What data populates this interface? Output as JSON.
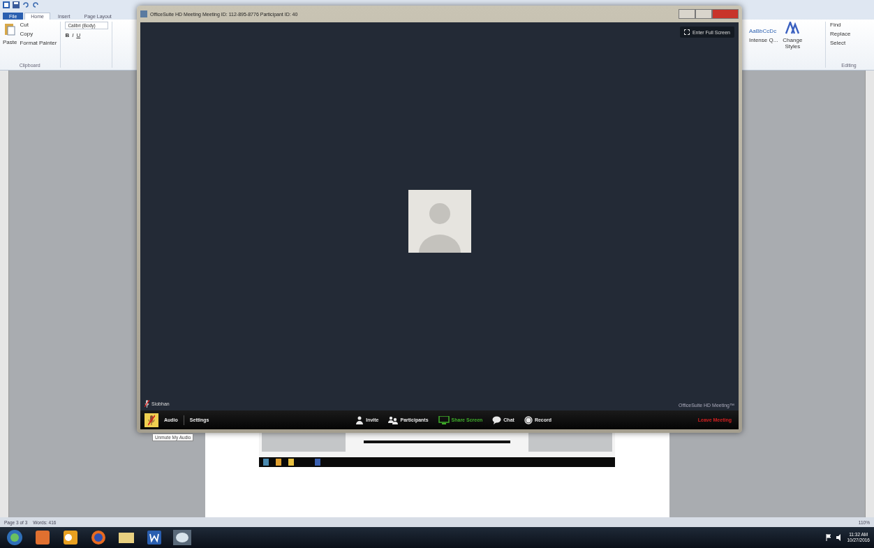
{
  "word": {
    "tabs": [
      {
        "label": "File",
        "selected": false,
        "kind": "file"
      },
      {
        "label": "Home",
        "selected": true,
        "kind": "tab"
      },
      {
        "label": "Insert",
        "selected": false,
        "kind": "tab"
      },
      {
        "label": "Page Layout",
        "selected": false,
        "kind": "tab"
      }
    ],
    "clipboard": {
      "paste": "Paste",
      "cut": "Cut",
      "copy": "Copy",
      "format_painter": "Format Painter",
      "group": "Clipboard"
    },
    "font": {
      "name": "Calibri (Body)",
      "bold": "B",
      "italic": "I",
      "underline": "U"
    },
    "styles": {
      "sample": "AaBbCcDc",
      "style_name": "Intense Q...",
      "change_styles": "Change Styles"
    },
    "editing": {
      "find": "Find",
      "replace": "Replace",
      "select": "Select",
      "group": "Editing"
    },
    "status_bar": {
      "page": "Page 3 of 3",
      "words": "Words: 416",
      "zoom": "110%"
    }
  },
  "meeting": {
    "title": "OfficeSuite HD Meeting Meeting ID: 112-895-8776 Participant ID: 40",
    "full_screen": "Enter Full Screen",
    "participant_name": "Siobhan",
    "branding": "OfficeSuite HD Meeting™",
    "muted": true,
    "left_controls": [
      "Audio",
      "Settings"
    ],
    "toolbar": [
      {
        "label": "Invite",
        "kind": "invite",
        "color": "#e8e8e8"
      },
      {
        "label": "Participants",
        "kind": "participants",
        "color": "#e8e8e8"
      },
      {
        "label": "Share Screen",
        "kind": "share",
        "color": "#3fae2a"
      },
      {
        "label": "Chat",
        "kind": "chat",
        "color": "#e8e8e8"
      },
      {
        "label": "Record",
        "kind": "record",
        "color": "#e8e8e8"
      }
    ],
    "leave": {
      "label": "Leave Meeting",
      "color": "#d42020"
    },
    "tooltip": "Unmute My Audio"
  },
  "taskbar": {
    "time": "11:32 AM",
    "date": "10/27/2016"
  }
}
